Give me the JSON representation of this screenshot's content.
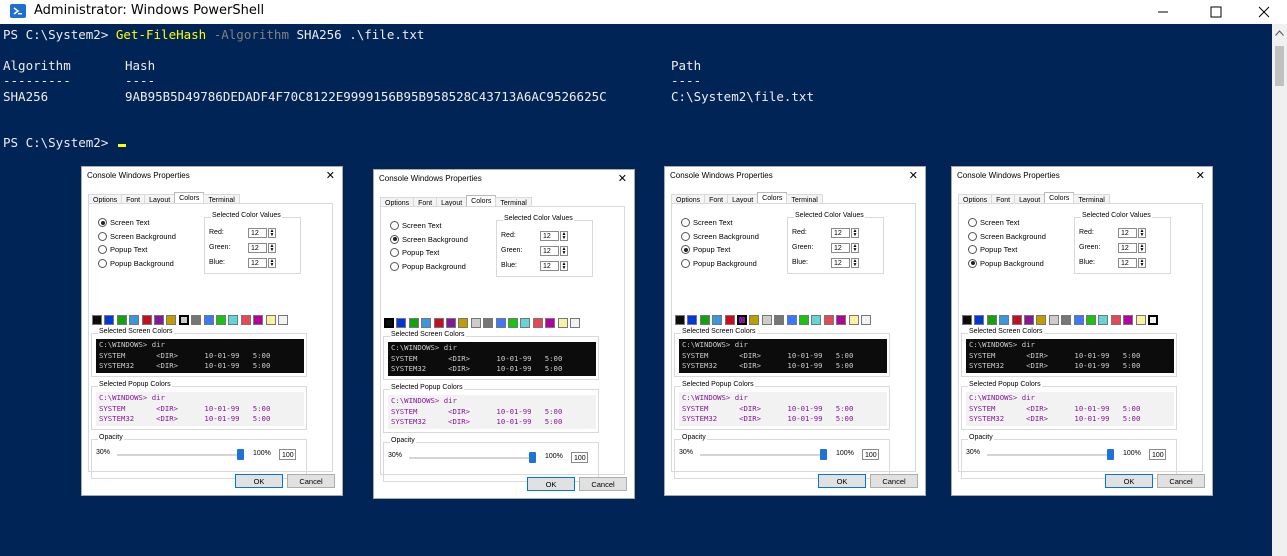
{
  "window": {
    "title": "Administrator: Windows PowerShell",
    "icon": "powershell-icon"
  },
  "console": {
    "prompt": "PS C:\\System2> ",
    "command_name": "Get-FileHash",
    "command_param": " -Algorithm",
    "command_args": " SHA256 .\\file.txt",
    "table_headers": [
      "Algorithm",
      "Hash",
      "Path"
    ],
    "table_underlines": [
      "---------",
      "----",
      "----"
    ],
    "table_row": [
      "SHA256",
      "9AB95B5D49786DEDADF4F70C8122E9999156B95B958528C43713A6AC9526625C",
      "C:\\System2\\file.txt"
    ],
    "prompt2": "PS C:\\System2> ",
    "colors": {
      "background": "#012456",
      "foreground": "#eeedf0",
      "cmdlet": "#ffff00",
      "parameter": "#808080"
    }
  },
  "dialog_template": {
    "title": "Console Windows Properties",
    "close_label": "✕",
    "tabs": [
      "Options",
      "Font",
      "Layout",
      "Colors",
      "Terminal"
    ],
    "active_tab": "Colors",
    "radio_labels": [
      "Screen Text",
      "Screen Background",
      "Popup Text",
      "Popup Background"
    ],
    "color_values_label": "Selected Color Values",
    "rgb_labels": [
      "Red:",
      "Green:",
      "Blue:"
    ],
    "rgb_values": [
      "12",
      "12",
      "12"
    ],
    "screen_colors_label": "Selected Screen Colors",
    "popup_colors_label": "Selected Popup Colors",
    "preview_lines": [
      "C:\\WINDOWS> dir",
      "SYSTEM       <DIR>      10-01-99   5:00",
      "SYSTEM32     <DIR>      10-01-99   5:00"
    ],
    "opacity_label": "Opacity",
    "opacity_min": "30%",
    "opacity_max": "100%",
    "opacity_value": "100",
    "opacity_level": 1.0,
    "ok_label": "OK",
    "cancel_label": "Cancel",
    "palette": [
      "#0c0c0c",
      "#0037da",
      "#13a10e",
      "#3a96dd",
      "#c50f1f",
      "#881798",
      "#c19c00",
      "#cccccc",
      "#767676",
      "#3b78ff",
      "#16c60c",
      "#61d6d6",
      "#e74856",
      "#b4009e",
      "#f9f1a5",
      "#f2f2f2"
    ],
    "screen_preview_colors": {
      "bg": "#0c0c0c",
      "fg": "#cccccc"
    },
    "popup_preview_colors": {
      "bg": "#f2f2f2",
      "fg": "#881798"
    }
  },
  "dialogs": [
    {
      "selected_radio": 0,
      "selected_swatch": 7
    },
    {
      "selected_radio": 1,
      "selected_swatch": 0
    },
    {
      "selected_radio": 2,
      "selected_swatch": 5
    },
    {
      "selected_radio": 3,
      "selected_swatch": 15
    }
  ]
}
